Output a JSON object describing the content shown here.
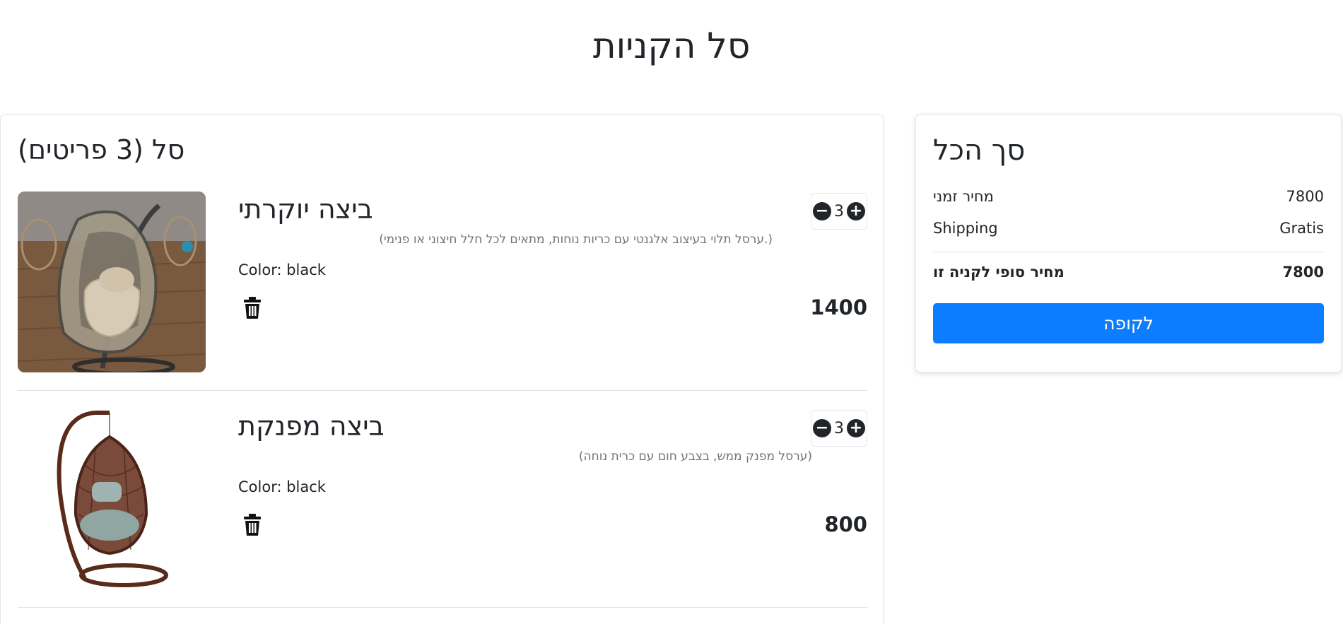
{
  "page": {
    "title": "סל הקניות"
  },
  "cart": {
    "heading": "סל (3 פריטים)",
    "items": [
      {
        "name": "ביצה יוקרתי",
        "description": "(.ערסל תלוי בעיצוב אלגנטי עם כריות נוחות, מתאים לכל חלל חיצוני או פנימי)",
        "color": "Color: black",
        "price": "1400",
        "quantity": "3",
        "image": "hanging-egg-chair-photo"
      },
      {
        "name": "ביצה מפנקת",
        "description": "(ערסל מפנק ממש, בצבע חום עם כרית נוחה)",
        "color": "Color: black",
        "price": "800",
        "quantity": "3",
        "image": "hanging-egg-chair-cutout"
      }
    ],
    "qty_minus": "−",
    "qty_plus": "+",
    "icons": {
      "delete": "trash-icon"
    }
  },
  "summary": {
    "title": "סך הכל",
    "subtotal_label": "מחיר זמני",
    "subtotal_value": "7800",
    "shipping_label": "Shipping",
    "shipping_value": "Gratis",
    "total_label": "מחיר סופי לקניה זו",
    "total_value": "7800",
    "checkout_label": "לקופה"
  },
  "colors": {
    "accent": "#0d7dff",
    "text": "#212529",
    "muted": "#6c757d"
  }
}
